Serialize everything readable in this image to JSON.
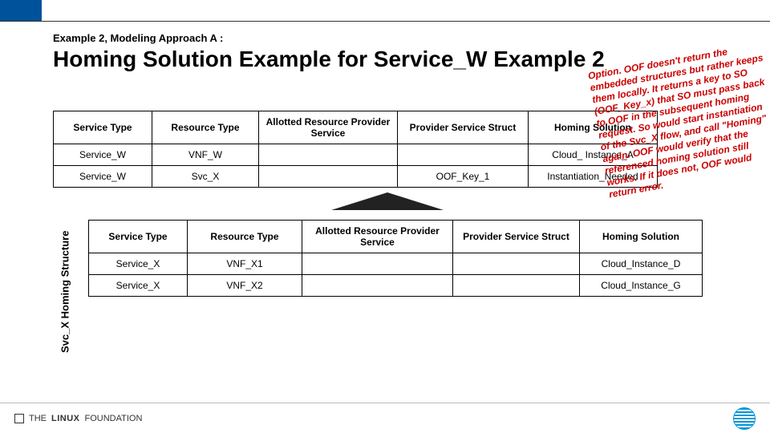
{
  "subhead": "Example 2, Modeling Approach A :",
  "title": "Homing Solution Example for Service_W Example 2",
  "table1": {
    "headers": [
      "Service Type",
      "Resource Type",
      "Allotted Resource Provider Service",
      "Provider Service Struct",
      "Homing Solution"
    ],
    "rows": [
      {
        "service_type": "Service_W",
        "resource_type": "VNF_W",
        "arp_service": "",
        "provider_struct": "",
        "homing": "Cloud_ Instance_A"
      },
      {
        "service_type": "Service_W",
        "resource_type": "Svc_X",
        "arp_service": "",
        "provider_struct": "OOF_Key_1",
        "homing": "Instantiation_Needed"
      }
    ]
  },
  "vlabel": "Svc_X Homing Structure",
  "table2": {
    "headers": [
      "Service Type",
      "Resource Type",
      "Allotted Resource Provider Service",
      "Provider Service Struct",
      "Homing Solution"
    ],
    "rows": [
      {
        "service_type": "Service_X",
        "resource_type": "VNF_X1",
        "arp_service": "",
        "provider_struct": "",
        "homing": "Cloud_Instance_D"
      },
      {
        "service_type": "Service_X",
        "resource_type": "VNF_X2",
        "arp_service": "",
        "provider_struct": "",
        "homing": "Cloud_Instance_G"
      }
    ]
  },
  "note": "Option. OOF doesn't return the embedded structures but rather keeps them locally.  It returns a key to SO (OOF_Key_x) that SO must pass back to OOF in the subsequent homing request.  So would start instantiation of the Svc_X flow, and call \"Homing\" again.  OOF would verify that the referenced homing solution still works.  If it does not, OOF would return error.",
  "footer_brand_pre": "THE",
  "footer_brand_main": "LINUX",
  "footer_brand_post": "FOUNDATION"
}
